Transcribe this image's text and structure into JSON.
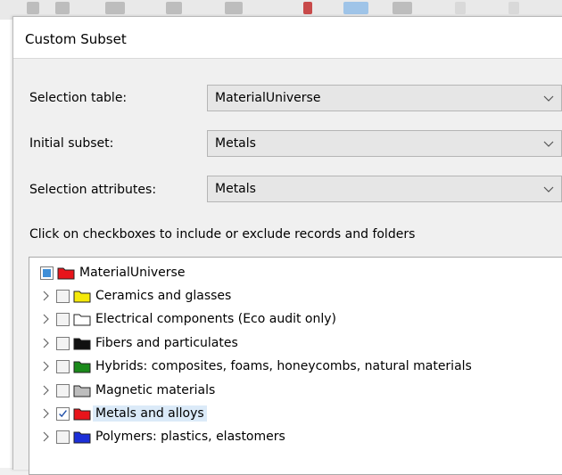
{
  "dialog": {
    "title": "Custom Subset",
    "selection_table": {
      "label": "Selection table:",
      "value": "MaterialUniverse"
    },
    "initial_subset": {
      "label": "Initial subset:",
      "value": "Metals"
    },
    "selection_attributes": {
      "label": "Selection attributes:",
      "value": "Metals"
    },
    "hint": "Click on checkboxes to include or exclude records and folders"
  },
  "tree": {
    "root": {
      "label": "MaterialUniverse",
      "state": "partial",
      "folder_color": "#e8141b"
    },
    "items": [
      {
        "label": "Ceramics and glasses",
        "checked": false,
        "folder_color": "#f5e90a"
      },
      {
        "label": "Electrical components (Eco audit only)",
        "checked": false,
        "folder_color": "#ffffff"
      },
      {
        "label": "Fibers and particulates",
        "checked": false,
        "folder_color": "#111111"
      },
      {
        "label": "Hybrids: composites, foams, honeycombs, natural materials",
        "checked": false,
        "folder_color": "#1a8a1a"
      },
      {
        "label": "Magnetic materials",
        "checked": false,
        "folder_color": "#bdbdbd"
      },
      {
        "label": "Metals and alloys",
        "checked": true,
        "folder_color": "#e8141b",
        "selected": true
      },
      {
        "label": "Polymers: plastics, elastomers",
        "checked": false,
        "folder_color": "#1c2fd8"
      }
    ]
  },
  "colors": {
    "selection_highlight": "#dbeaf8",
    "checkmark": "#1f4fa8",
    "partial_fill": "#3f8fd8"
  }
}
